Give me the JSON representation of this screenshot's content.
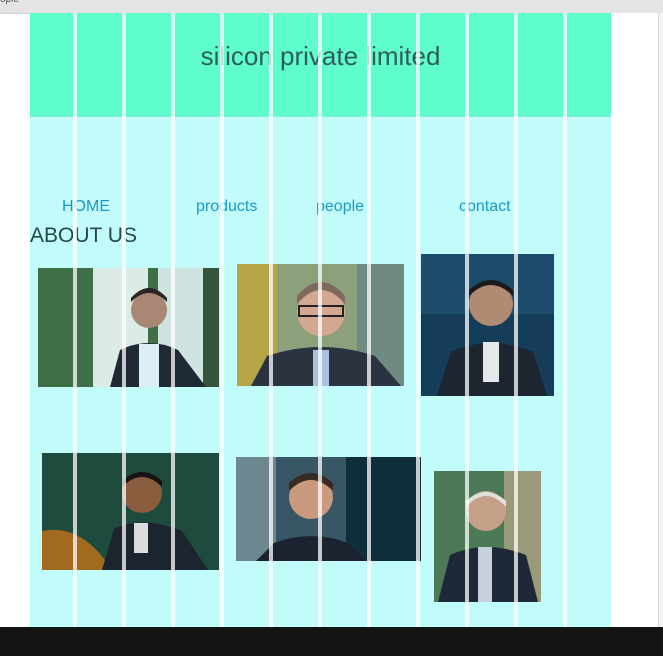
{
  "window": {
    "tab_label": "ople"
  },
  "header": {
    "title": "silicon private limited"
  },
  "nav": {
    "home": "HOME",
    "products": "products",
    "people": "people",
    "contact": "contact"
  },
  "section": {
    "heading": "ABOUT US"
  },
  "photos": [
    "portrait-1",
    "portrait-2",
    "portrait-3",
    "portrait-4",
    "portrait-5",
    "portrait-6"
  ],
  "colors": {
    "header_bg": "#5ffdcc",
    "page_bg": "#c2fcfa",
    "nav_link": "#1b98c8",
    "title_text": "#2d5d5c"
  }
}
